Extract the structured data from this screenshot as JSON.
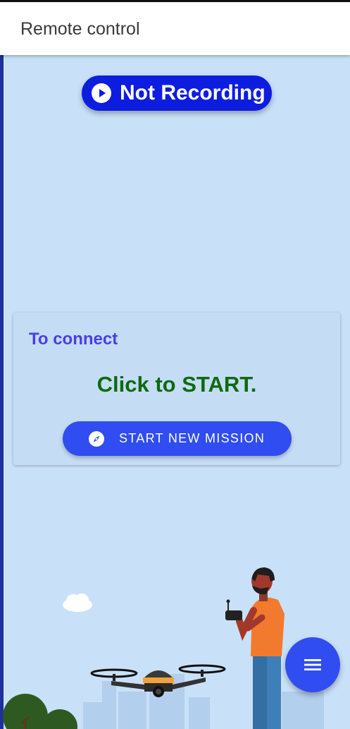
{
  "app_bar": {
    "title": "Remote control"
  },
  "recording": {
    "label": "Not Recording",
    "icon": "play-circle-icon"
  },
  "card": {
    "heading": "To connect",
    "message": "Click to START.",
    "start_button": {
      "label": "START NEW MISSION",
      "icon": "compass-icon"
    }
  },
  "fab": {
    "icon": "menu-icon"
  },
  "colors": {
    "background": "#c9e1f8",
    "primary": "#2f4df0",
    "recording_pill": "#0d1de0",
    "heading": "#4a3ee3",
    "cta": "#0d6a0d"
  }
}
